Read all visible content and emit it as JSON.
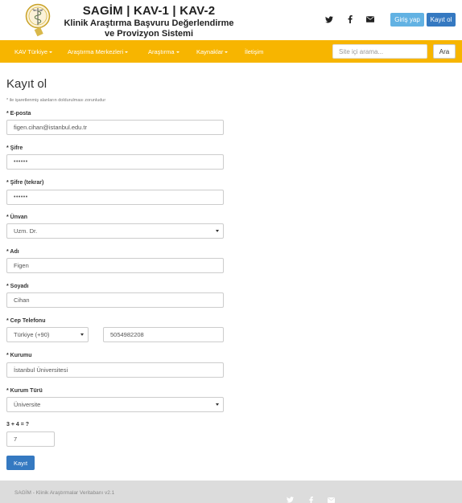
{
  "header": {
    "brand_line1": "SAGİM | KAV-1 | KAV-2",
    "brand_line2": "Klinik Araştırma Başvuru Değerlendirme",
    "brand_line3": "ve Provizyon Sistemi",
    "login_label": "Giriş yap",
    "register_label": "Kayıt ol",
    "social_icons": [
      "twitter-icon",
      "facebook-icon",
      "envelope-icon"
    ]
  },
  "nav": {
    "items": [
      {
        "label": "KAV Türkiye"
      },
      {
        "label": "Araştırma Merkezleri"
      },
      {
        "label": "Araştırma"
      },
      {
        "label": "Kaynaklar"
      },
      {
        "label": "İletişim"
      }
    ],
    "search_placeholder": "Site içi arama...",
    "search_button": "Ara"
  },
  "form": {
    "title": "Kayıt ol",
    "required_note": "* ile işaretlenmiş alanların doldurulması zorunludur",
    "email_label": "* E-posta",
    "email_value": "figen.cihan@istanbul.edu.tr",
    "password_label": "* Şifre",
    "password_value": "••••••",
    "password_repeat_label": "* Şifre (tekrar)",
    "password_repeat_value": "••••••",
    "title_label": "* Ünvan",
    "title_value": "Uzm. Dr.",
    "first_name_label": "* Adı",
    "first_name_value": "Figen",
    "last_name_label": "* Soyadı",
    "last_name_value": "Cihan",
    "phone_label": "* Cep Telefonu",
    "country_code_value": "Türkiye (+90)",
    "phone_value": "5054982208",
    "institution_label": "* Kurumu",
    "institution_value": "İstanbul Üniversitesi",
    "institution_type_label": "* Kurum Türü",
    "institution_type_value": "Üniversite",
    "captcha_question": "3 + 4 = ?",
    "captcha_value": "7",
    "submit_label": "Kayıt"
  },
  "footer": {
    "text": "SAGİM - Klinik Araştırmalar Veritabanı v2.1",
    "icons": [
      "twitter-icon",
      "facebook-icon",
      "envelope-icon"
    ]
  },
  "colors": {
    "nav_bg": "#f7b500",
    "login_btn": "#62b2e3",
    "primary_btn": "#3579c1",
    "footer_bg": "#dcdcdc"
  }
}
